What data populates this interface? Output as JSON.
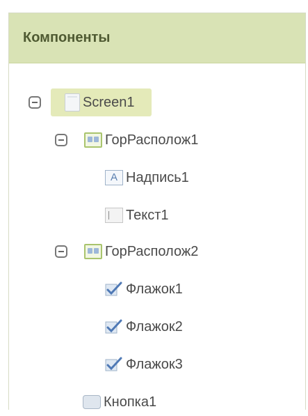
{
  "panel": {
    "title": "Компоненты"
  },
  "tree": {
    "screen": {
      "label": "Screen1"
    },
    "hor1": {
      "label": "ГорРасполож1"
    },
    "label1": {
      "label": "Надпись1"
    },
    "text1": {
      "label": "Текст1"
    },
    "hor2": {
      "label": "ГорРасполож2"
    },
    "check1": {
      "label": "Флажок1"
    },
    "check2": {
      "label": "Флажок2"
    },
    "check3": {
      "label": "Флажок3"
    },
    "button1": {
      "label": "Кнопка1"
    }
  },
  "icons": {
    "screen": "screen-icon",
    "arrangement": "horizontal-arrangement-icon",
    "label": "label-icon",
    "textbox": "textbox-icon",
    "checkbox": "checkbox-icon",
    "button": "button-icon"
  },
  "colors": {
    "header": "#d9e3b5",
    "selection": "#e4eab9",
    "text": "#4a4a4a"
  }
}
